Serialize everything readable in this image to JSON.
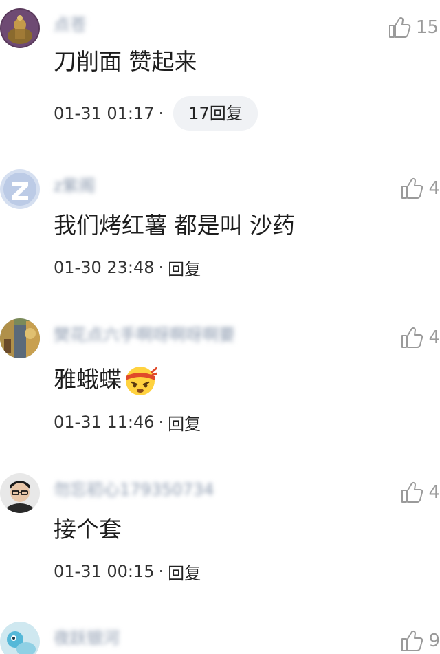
{
  "comments": [
    {
      "username": "点苍",
      "likes": "15",
      "text": "刀削面  赞起来",
      "time": "01-31 01:17",
      "reply_label": "17回复"
    },
    {
      "username": "z紫阁",
      "likes": "4",
      "text": "我们烤红薯 都是叫 沙药",
      "time": "01-30 23:48",
      "reply_label": "回复"
    },
    {
      "username": "樊花点六手啊呀啊呀啊要",
      "likes": "4",
      "text": "雅蛾蝶",
      "time": "01-31 11:46",
      "reply_label": "回复"
    },
    {
      "username": "勿忘初心179350734",
      "likes": "4",
      "text": "接个套",
      "time": "01-31 00:15",
      "reply_label": "回复"
    },
    {
      "username": "夜跃银河",
      "likes": "9"
    }
  ],
  "separator": "·",
  "icons": {
    "like": "thumbs-up-icon",
    "emoji": "angry-headband-emoji"
  },
  "colors": {
    "username": "#8a98ad",
    "meta": "#333333",
    "reply_pill_bg": "#f0f2f5",
    "like": "#9a9a9a"
  }
}
